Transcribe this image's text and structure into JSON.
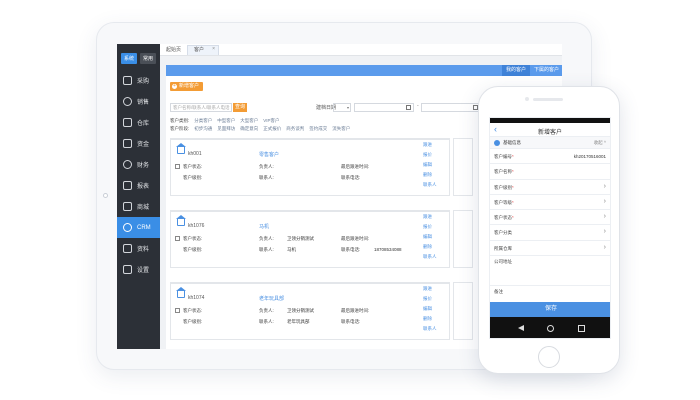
{
  "sidebar": {
    "tabs": [
      "系统",
      "常用"
    ],
    "items": [
      {
        "label": "采购",
        "icon": "cart-icon"
      },
      {
        "label": "销售",
        "icon": "sales-icon"
      },
      {
        "label": "仓库",
        "icon": "warehouse-icon"
      },
      {
        "label": "资金",
        "icon": "money-icon"
      },
      {
        "label": "财务",
        "icon": "finance-icon"
      },
      {
        "label": "报表",
        "icon": "report-icon"
      },
      {
        "label": "商城",
        "icon": "shop-icon"
      },
      {
        "label": "CRM",
        "icon": "crm-icon"
      },
      {
        "label": "资料",
        "icon": "docs-icon"
      },
      {
        "label": "设置",
        "icon": "gear-icon"
      }
    ],
    "active_index": 7
  },
  "topbar": {
    "tabs": [
      "起始页",
      "客户"
    ]
  },
  "content": {
    "toggle_tabs": [
      "我的客户",
      "下属的客户"
    ],
    "add_button": "新增客户",
    "search_placeholder": "客户名称/联系人/联系人电话",
    "search_button": "查询",
    "date_label": "建档日期",
    "filter1_label": "客户类别:",
    "filter1_options": [
      "分类客户",
      "中型客户",
      "大型客户",
      "VIP客户"
    ],
    "filter2_label": "客户阶段:",
    "filter2_options": [
      "初步沟通",
      "见面拜访",
      "确定意向",
      "正式报价",
      "商务谈判",
      "签约成交",
      "流失客户"
    ]
  },
  "cards": [
    {
      "code": "kh001",
      "name": "零售客户",
      "phone": "",
      "rep_label": "负责人:",
      "rep": "",
      "contact": "",
      "status": "",
      "stage": ""
    },
    {
      "code": "kh1076",
      "name": "马机",
      "phone": "18708534088",
      "rep_label": "负责人:",
      "rep": "卫领分销测试",
      "contact": "马机",
      "status": "",
      "stage": ""
    },
    {
      "code": "kh1074",
      "name": "老年玩具部",
      "phone": "",
      "rep_label": "负责人:",
      "rep": "卫领分销测试",
      "contact": "老年玩具部",
      "status": "",
      "stage": ""
    }
  ],
  "card_labels": {
    "status": "客户状态:",
    "stage": "客户级别:",
    "contact": "联系人:",
    "last_follow": "最后跟进时间:",
    "phone": "联系电话:"
  },
  "card_actions": [
    "跟进",
    "报价",
    "编辑",
    "删除",
    "联系人"
  ],
  "phone": {
    "title": "新增客户",
    "section": "基础信息",
    "collapse": "收起 ^",
    "fields": [
      {
        "label": "客户编号",
        "req": true,
        "value": "kh20170516001"
      },
      {
        "label": "客户名称",
        "req": true,
        "value": ""
      },
      {
        "label": "客户级别",
        "req": true,
        "value": ""
      },
      {
        "label": "客户等级",
        "req": true,
        "value": ""
      },
      {
        "label": "客户状态",
        "req": true,
        "value": ""
      },
      {
        "label": "客户分类",
        "req": false,
        "value": ""
      },
      {
        "label": "所属仓库",
        "req": false,
        "value": ""
      }
    ],
    "address_label": "公司地址",
    "note_label": "备注",
    "save_button": "保存"
  }
}
